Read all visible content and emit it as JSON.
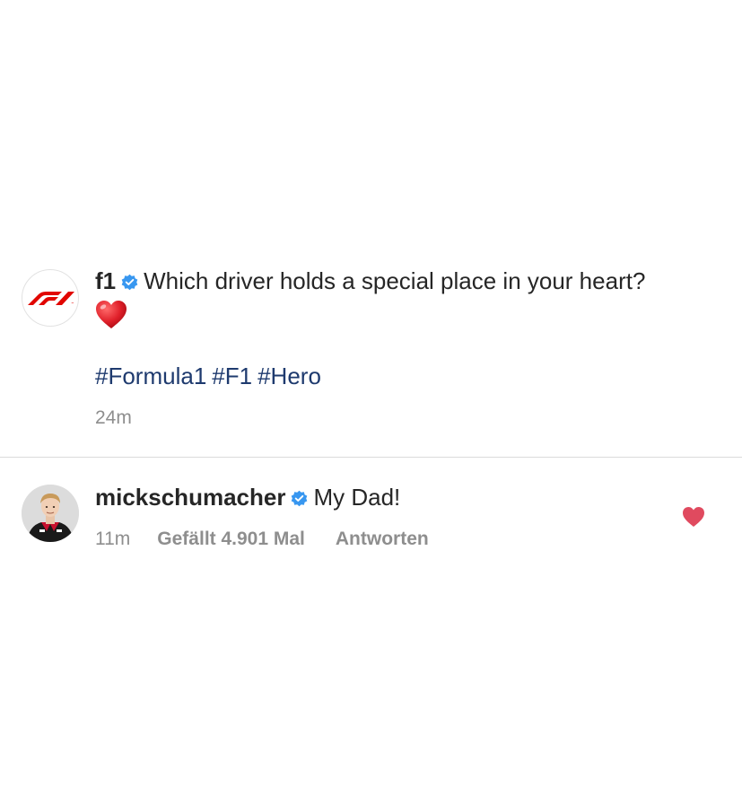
{
  "post": {
    "username": "f1",
    "caption": "Which driver holds a special place in your heart?",
    "emoji_icon": "red-heart-emoji",
    "hashtags": [
      "#Formula1",
      "#F1",
      "#Hero"
    ],
    "time": "24m"
  },
  "comment": {
    "username": "mickschumacher",
    "text": "My Dad!",
    "time": "11m",
    "likes": "Gefällt 4.901 Mal",
    "reply_label": "Antworten",
    "liked": true
  },
  "colors": {
    "verified_badge": "#3897f0",
    "hashtag": "#1e3a6e",
    "meta_text": "#8e8e8e",
    "like_heart": "#e04a5f",
    "f1_red": "#e10600"
  }
}
